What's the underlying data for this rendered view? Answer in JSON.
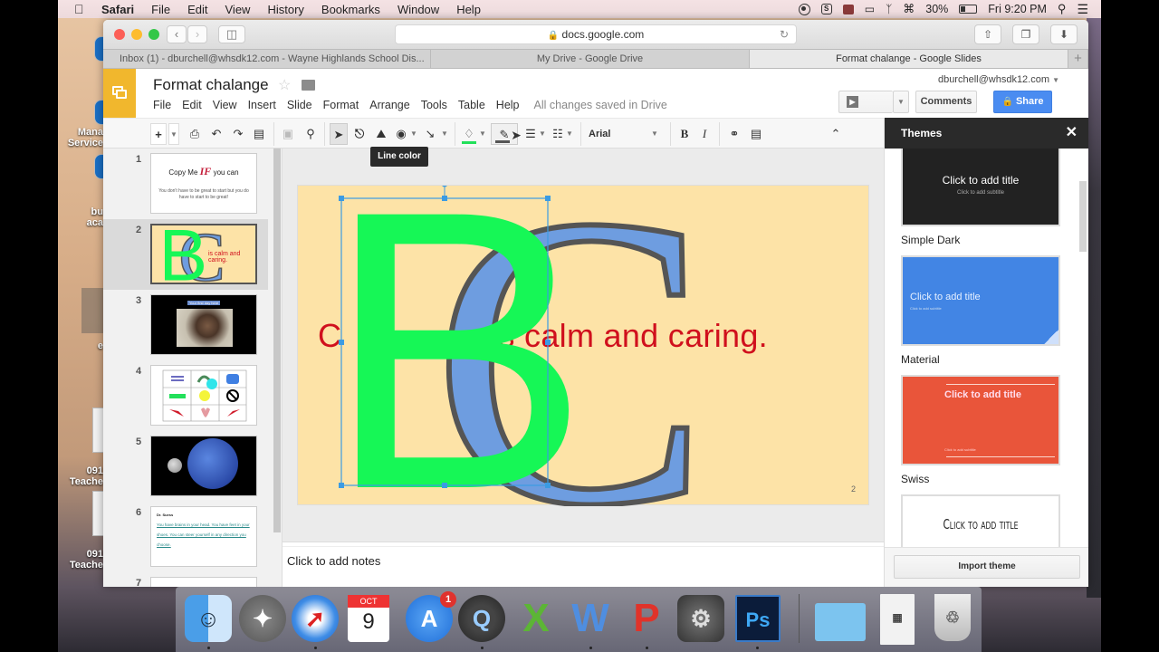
{
  "menubar": {
    "app": "Safari",
    "items": [
      "File",
      "Edit",
      "View",
      "History",
      "Bookmarks",
      "Window",
      "Help"
    ],
    "battery": "30%",
    "clock": "Fri 9:20 PM"
  },
  "browser": {
    "url": "docs.google.com",
    "tabs": [
      {
        "label": "Inbox (1) - dburchell@whsdk12.com - Wayne Highlands School Dis...",
        "active": false
      },
      {
        "label": "My Drive - Google Drive",
        "active": false
      },
      {
        "label": "Format chalange - Google Slides",
        "active": true
      }
    ],
    "new_tab": "+"
  },
  "app": {
    "doc_title": "Format chalange",
    "menu": [
      "File",
      "Edit",
      "View",
      "Insert",
      "Slide",
      "Format",
      "Arrange",
      "Tools",
      "Table",
      "Help"
    ],
    "save_status": "All changes saved in Drive",
    "user": "dburchell@whsdk12.com",
    "present_label": "Present",
    "comments_label": "Comments",
    "share_label": "Share",
    "accent": "#f1b72d",
    "share_color": "#4a8cf1"
  },
  "toolbar": {
    "font": "Arial",
    "tooltip": "Line color",
    "fill_color": "#22e05a"
  },
  "filmstrip": {
    "slides": [
      {
        "num": "1",
        "title": "Copy Me",
        "title_em": "IF",
        "title_end": "you can",
        "body": "You don't have to be great to start but you do have to start to be great!"
      },
      {
        "num": "2",
        "text": "is calm and caring.",
        "selected": true
      },
      {
        "num": "3",
        "caption": "Your first day here"
      },
      {
        "num": "4"
      },
      {
        "num": "5"
      },
      {
        "num": "6",
        "heading": "Dr. Suess",
        "body": "You have brains in your head. You have feet in your shoes. You can steer yourself in any direction you choose."
      },
      {
        "num": "7"
      }
    ]
  },
  "slide": {
    "text": "C                is calm and caring.",
    "letter_b": "B",
    "letter_c": "C",
    "number": "2",
    "b_color": "#16f756",
    "c_color": "#6e9de0",
    "text_color": "#d0101d",
    "bg_color": "#fde3a7"
  },
  "notes": {
    "placeholder": "Click to add notes"
  },
  "themes": {
    "title": "Themes",
    "close": "✕",
    "items": [
      {
        "name": "Simple Dark",
        "title": "Click to add title",
        "subtitle": "Click to add subtitle"
      },
      {
        "name": "Material",
        "title": "Click to add title",
        "subtitle": "Click to add subtitle"
      },
      {
        "name": "Swiss",
        "title": "Click to add title",
        "subtitle": "Click to add subtitle"
      },
      {
        "name": "",
        "title": "Click to add title"
      }
    ],
    "import_label": "Import theme"
  },
  "dock": {
    "apps": [
      "Finder",
      "Launchpad",
      "Safari",
      "Calendar",
      "App Store",
      "QuickTime",
      "Excel",
      "Word",
      "PowerPoint",
      "System Preferences",
      "Photoshop",
      "Folder",
      "Document",
      "Trash"
    ],
    "calendar_month": "OCT",
    "calendar_day": "9",
    "appstore_badge": "1",
    "photoshop_label": "Ps"
  },
  "desktop": {
    "labels": [
      "Mana",
      "Service",
      "bu",
      "aca",
      "e",
      "091",
      "Teache",
      "091",
      "Teache"
    ]
  }
}
